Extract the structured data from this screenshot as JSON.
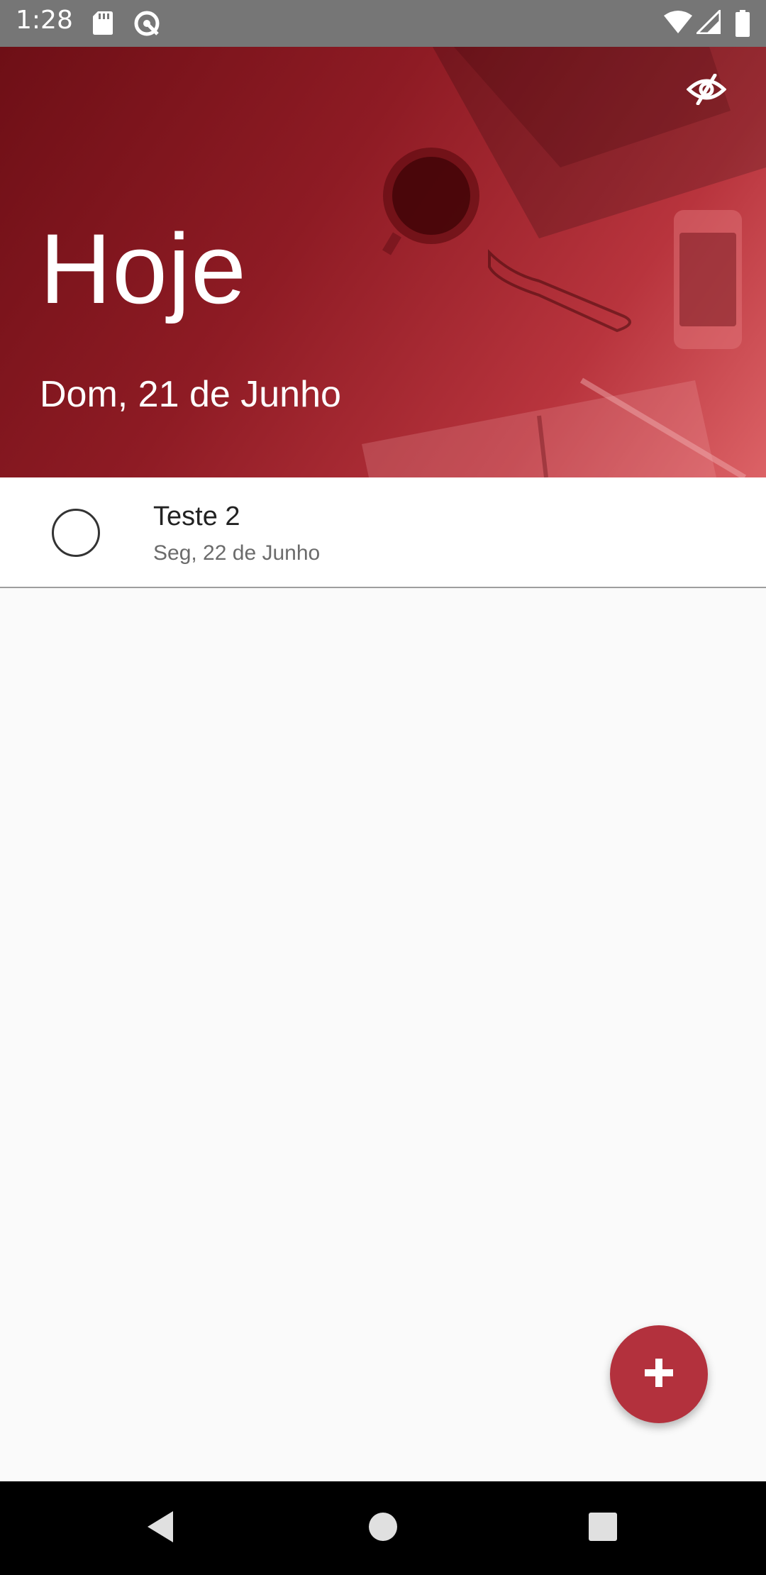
{
  "status_bar": {
    "time": "1:28",
    "icons": [
      "sd-card-icon",
      "sync-icon",
      "wifi-icon",
      "cell-signal-icon",
      "battery-icon"
    ]
  },
  "header": {
    "title": "Hoje",
    "date": "Dom, 21 de Junho",
    "toggle_icon": "eye-off-icon",
    "accent_color": "#8e1b24"
  },
  "tasks": [
    {
      "title": "Teste 2",
      "date": "Seg, 22 de Junho",
      "completed": false
    }
  ],
  "fab": {
    "icon": "plus-icon",
    "color": "#b3313d"
  },
  "nav_bar": {
    "buttons": [
      "back-icon",
      "home-icon",
      "recents-icon"
    ]
  }
}
